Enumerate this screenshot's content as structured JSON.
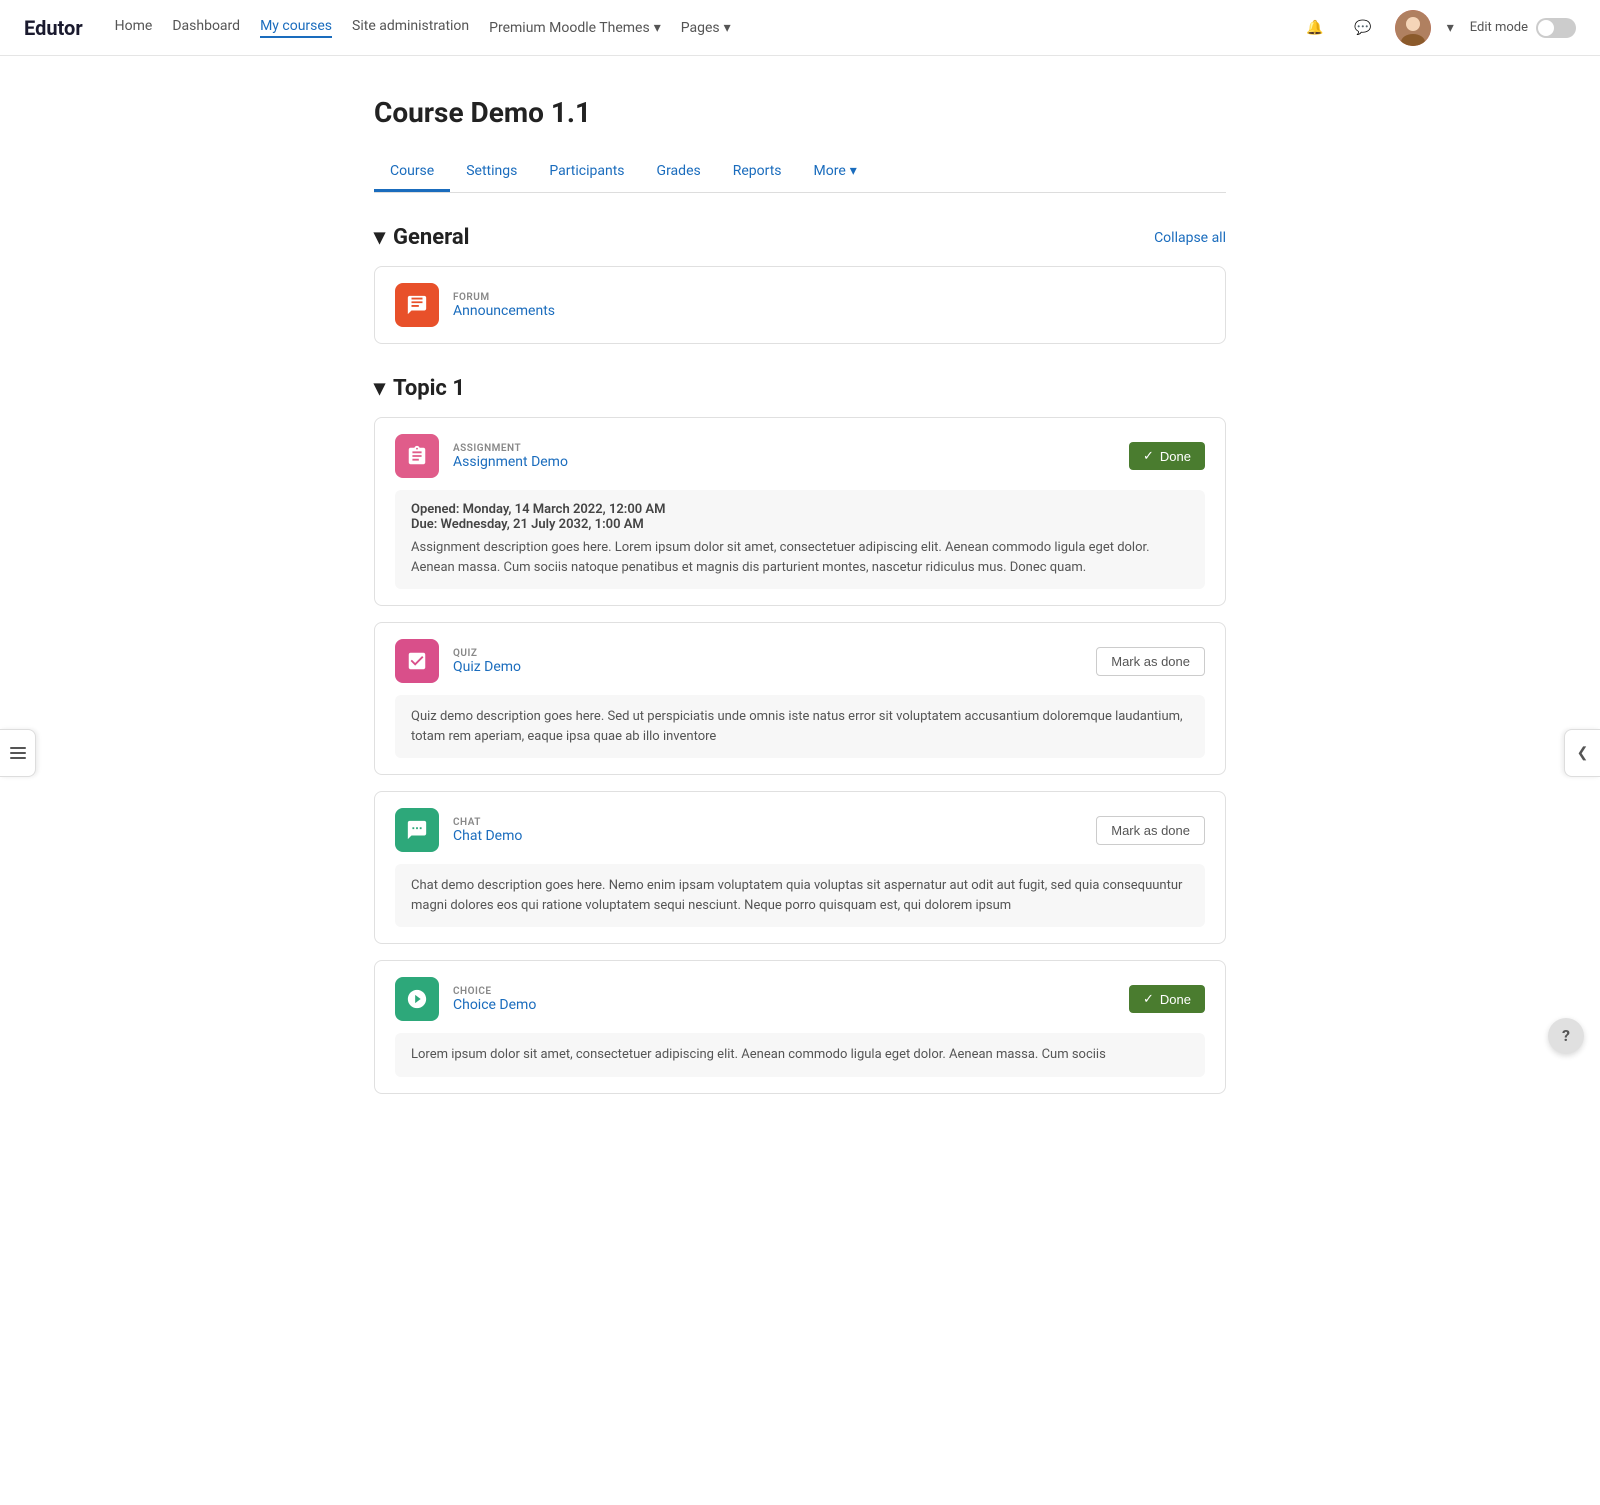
{
  "logo": "Edutor",
  "nav": {
    "links": [
      {
        "label": "Home",
        "active": false
      },
      {
        "label": "Dashboard",
        "active": false
      },
      {
        "label": "My courses",
        "active": true
      },
      {
        "label": "Site administration",
        "active": false
      },
      {
        "label": "Premium Moodle Themes",
        "active": false,
        "dropdown": true
      },
      {
        "label": "Pages",
        "active": false,
        "dropdown": true
      }
    ],
    "edit_mode_label": "Edit mode"
  },
  "page": {
    "title": "Course Demo 1.1"
  },
  "tabs": [
    {
      "label": "Course",
      "active": true
    },
    {
      "label": "Settings",
      "active": false
    },
    {
      "label": "Participants",
      "active": false
    },
    {
      "label": "Grades",
      "active": false
    },
    {
      "label": "Reports",
      "active": false
    },
    {
      "label": "More",
      "active": false,
      "dropdown": true
    }
  ],
  "sections": {
    "general": {
      "title": "General",
      "collapse_label": "Collapse all",
      "forum": {
        "type": "FORUM",
        "name": "Announcements"
      }
    },
    "topic1": {
      "title": "Topic 1",
      "activities": [
        {
          "id": "assignment",
          "type": "ASSIGNMENT",
          "name": "Assignment Demo",
          "icon_color": "#e05c8a",
          "status": "done",
          "btn_label": "Done",
          "opened_label": "Opened:",
          "opened_value": "Monday, 14 March 2022, 12:00 AM",
          "due_label": "Due:",
          "due_value": "Wednesday, 21 July 2032, 1:00 AM",
          "description": "Assignment description goes here. Lorem ipsum dolor sit amet, consectetuer adipiscing elit. Aenean commodo ligula eget dolor. Aenean massa. Cum sociis natoque penatibus et magnis dis parturient montes, nascetur ridiculus mus. Donec quam."
        },
        {
          "id": "quiz",
          "type": "QUIZ",
          "name": "Quiz Demo",
          "icon_color": "#d94f8a",
          "status": "mark",
          "btn_label": "Mark as done",
          "description": "Quiz demo description goes here. Sed ut perspiciatis unde omnis iste natus error sit voluptatem accusantium doloremque laudantium, totam rem aperiam, eaque ipsa quae ab illo inventore"
        },
        {
          "id": "chat",
          "type": "CHAT",
          "name": "Chat Demo",
          "icon_color": "#2da87a",
          "status": "mark",
          "btn_label": "Mark as done",
          "description": "Chat demo description goes here. Nemo enim ipsam voluptatem quia voluptas sit aspernatur aut odit aut fugit, sed quia consequuntur magni dolores eos qui ratione voluptatem sequi nesciunt. Neque porro quisquam est, qui dolorem ipsum"
        },
        {
          "id": "choice",
          "type": "CHOICE",
          "name": "Choice Demo",
          "icon_color": "#2da87a",
          "status": "done",
          "btn_label": "Done",
          "description": "Lorem ipsum dolor sit amet, consectetuer adipiscing elit. Aenean commodo ligula eget dolor. Aenean massa. Cum sociis"
        }
      ]
    }
  },
  "icons": {
    "chevron_left": "❮",
    "chevron_right": "❯",
    "chevron_down": "▾",
    "check": "✓",
    "help": "?",
    "bell": "🔔",
    "chat_bubble": "💬",
    "menu": "☰"
  }
}
